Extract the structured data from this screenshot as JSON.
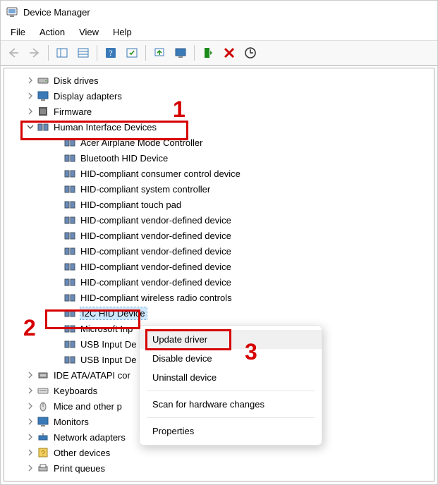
{
  "window": {
    "title": "Device Manager"
  },
  "menu": {
    "file": "File",
    "action": "Action",
    "view": "View",
    "help": "Help"
  },
  "toolbar_icons": {
    "back": "back-arrow-icon",
    "forward": "forward-arrow-icon",
    "show_hide": "show-hide-console-tree-icon",
    "view_menu": "view-menu-icon",
    "help": "help-icon",
    "refresh": "refresh-icon",
    "update": "update-driver-icon",
    "monitor": "monitor-icon",
    "enable": "enable-device-icon",
    "disable": "disable-device-icon",
    "scan": "scan-hardware-icon"
  },
  "tree": {
    "categories": [
      {
        "label": "Disk drives",
        "expanded": false,
        "icon": "disk"
      },
      {
        "label": "Display adapters",
        "expanded": false,
        "icon": "display"
      },
      {
        "label": "Firmware",
        "expanded": false,
        "icon": "firmware"
      },
      {
        "label": "Human Interface Devices",
        "expanded": true,
        "icon": "hid",
        "children": [
          "Acer Airplane Mode Controller",
          "Bluetooth HID Device",
          "HID-compliant consumer control device",
          "HID-compliant system controller",
          "HID-compliant touch pad",
          "HID-compliant vendor-defined device",
          "HID-compliant vendor-defined device",
          "HID-compliant vendor-defined device",
          "HID-compliant vendor-defined device",
          "HID-compliant vendor-defined device",
          "HID-compliant wireless radio controls",
          "I2C HID Device",
          "Microsoft Inp",
          "USB Input De",
          "USB Input De"
        ],
        "selected_index": 11
      },
      {
        "label": "IDE ATA/ATAPI cor",
        "expanded": false,
        "icon": "ide"
      },
      {
        "label": "Keyboards",
        "expanded": false,
        "icon": "keyboard"
      },
      {
        "label": "Mice and other p",
        "expanded": false,
        "icon": "mouse"
      },
      {
        "label": "Monitors",
        "expanded": false,
        "icon": "monitor"
      },
      {
        "label": "Network adapters",
        "expanded": false,
        "icon": "network"
      },
      {
        "label": "Other devices",
        "expanded": false,
        "icon": "other"
      },
      {
        "label": "Print queues",
        "expanded": false,
        "icon": "print"
      }
    ]
  },
  "context_menu": {
    "items": [
      "Update driver",
      "Disable device",
      "Uninstall device"
    ],
    "items2": [
      "Scan for hardware changes"
    ],
    "items3": [
      "Properties"
    ],
    "highlighted": 0
  },
  "annotations": {
    "n1": "1",
    "n2": "2",
    "n3": "3"
  }
}
